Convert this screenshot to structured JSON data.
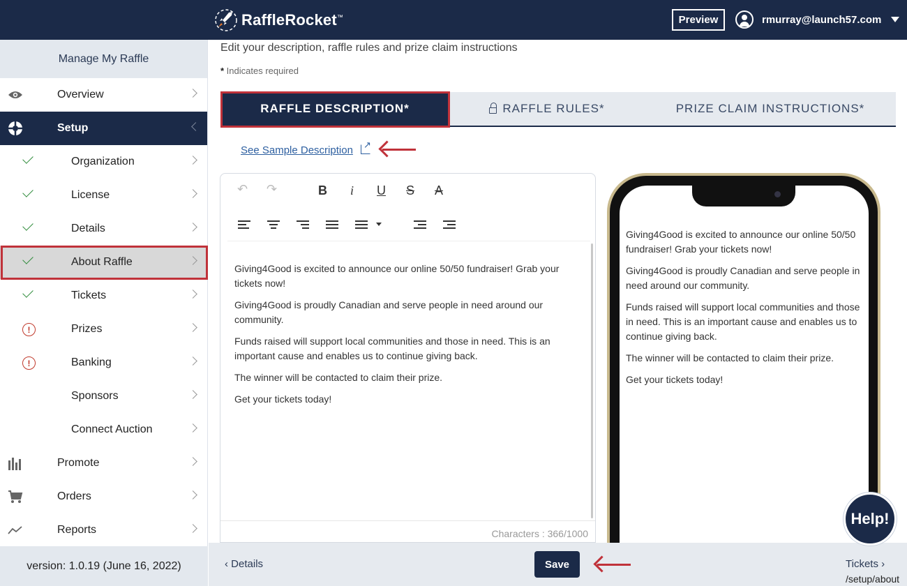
{
  "header": {
    "logo_text": "RaffleRocket",
    "logo_tm": "™",
    "preview_label": "Preview",
    "user_email": "rmurray@launch57.com"
  },
  "sidebar": {
    "title": "Manage My Raffle",
    "items": [
      {
        "label": "Overview",
        "icon": "eye-icon"
      },
      {
        "label": "Setup",
        "icon": "lifebuoy-icon"
      },
      {
        "label": "Organization",
        "status": "complete"
      },
      {
        "label": "License",
        "status": "complete"
      },
      {
        "label": "Details",
        "status": "complete"
      },
      {
        "label": "About Raffle",
        "status": "complete"
      },
      {
        "label": "Tickets",
        "status": "complete"
      },
      {
        "label": "Prizes",
        "status": "warning"
      },
      {
        "label": "Banking",
        "status": "warning"
      },
      {
        "label": "Sponsors",
        "status": "none"
      },
      {
        "label": "Connect Auction",
        "status": "none"
      },
      {
        "label": "Promote",
        "icon": "bar-chart-icon"
      },
      {
        "label": "Orders",
        "icon": "cart-icon"
      },
      {
        "label": "Reports",
        "icon": "trend-icon"
      }
    ],
    "warning_glyph": "!",
    "version": "version: 1.0.19 (June 16, 2022)"
  },
  "main": {
    "subtitle": "Edit your description, raffle rules and prize claim instructions",
    "required_star": "*",
    "required_note": " Indicates required",
    "tabs": [
      {
        "label": "RAFFLE DESCRIPTION*"
      },
      {
        "label": "RAFFLE RULES*"
      },
      {
        "label": "PRIZE CLAIM INSTRUCTIONS*"
      }
    ],
    "sample_link": "See Sample Description",
    "editor": {
      "paragraphs": [
        "Giving4Good is excited to announce our online 50/50 fundraiser! Grab your tickets now!",
        "Giving4Good is proudly Canadian and serve people in need around our community.",
        "Funds raised will support local communities and those in need. This is an important cause and enables us to continue giving back.",
        "The winner will be contacted to claim their prize.",
        "Get your tickets today!"
      ],
      "counter": "Characters : 366/1000",
      "toolbar": {
        "undo": "↶",
        "redo": "↷",
        "bold": "B",
        "italic": "i",
        "underline": "U",
        "strike": "S",
        "clear": "A"
      }
    }
  },
  "footer_nav": {
    "back_label": "Details",
    "back_glyph": "‹",
    "save_label": "Save",
    "next_label": "Tickets",
    "next_glyph": "›",
    "url_fragment": "/setup/about"
  },
  "help_label": "Help!",
  "colors": {
    "navy": "#1b2a48",
    "highlight_red": "#c0323a",
    "link_blue": "#2d5fa0",
    "success_green": "#2e8b3a",
    "warning_red": "#c0392b"
  }
}
